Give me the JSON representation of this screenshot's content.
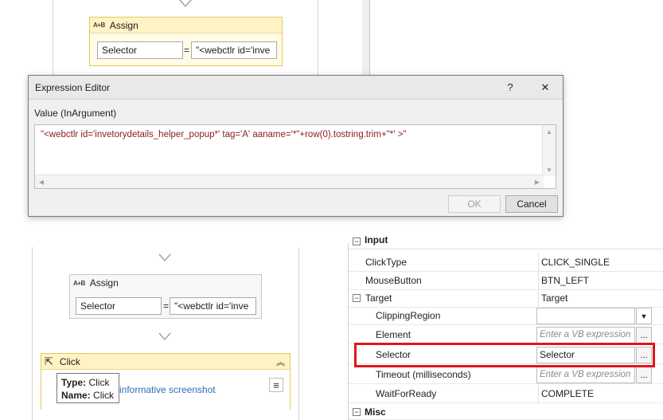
{
  "top_workflow": {
    "assign": {
      "title": "Assign",
      "left_value": "Selector",
      "equals": "=",
      "right_value": "\"<webctlr id='inve"
    }
  },
  "dialog": {
    "title": "Expression Editor",
    "help": "?",
    "close": "✕",
    "label": "Value (InArgument)",
    "expression": "\"<webctlr id='invetorydetails_helper_popup*' tag='A' aaname='*\"+row(0).tostring.trim+\"*' >\"",
    "ok_label": "OK",
    "cancel_label": "Cancel"
  },
  "bottom_workflow": {
    "assign": {
      "title": "Assign",
      "left_value": "Selector",
      "equals": "=",
      "right_value": "\"<webctlr id='inve"
    },
    "click": {
      "title": "Click",
      "tooltip_type_label": "Type:",
      "tooltip_type_value": "Click",
      "tooltip_name_label": "Name:",
      "tooltip_name_value": "Click",
      "link_text": "informative screenshot"
    }
  },
  "properties": {
    "section_input": "Input",
    "rows": [
      {
        "name": "ClickType",
        "value": "CLICK_SINGLE"
      },
      {
        "name": "MouseButton",
        "value": "BTN_LEFT"
      },
      {
        "name": "Target",
        "value": "Target"
      },
      {
        "name": "ClippingRegion",
        "value": ""
      },
      {
        "name": "Element",
        "value": "Enter a VB expression"
      },
      {
        "name": "Selector",
        "value": "Selector"
      },
      {
        "name": "Timeout (milliseconds)",
        "value": "Enter a VB expression"
      },
      {
        "name": "WaitForReady",
        "value": "COMPLETE"
      }
    ],
    "section_misc": "Misc",
    "ellipsis": "...",
    "collapse_glyph": "−"
  },
  "colors": {
    "highlight": "#e0161b",
    "activity_yellow": "#fffbe6",
    "expression_text": "#8b1a1a",
    "link": "#2e6fb6"
  }
}
